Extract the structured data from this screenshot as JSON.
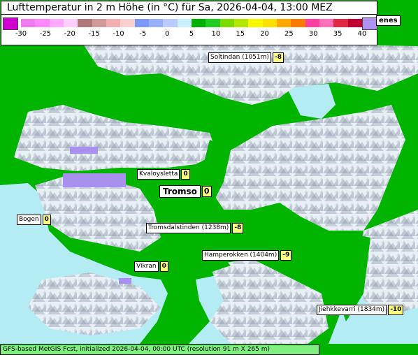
{
  "title": "Lufttemperatur in 2 m Höhe (in °C) für Sa, 2026-04-04, 13:00 MEZ",
  "scale": {
    "colors": [
      "#f07cf0",
      "#ff88ff",
      "#ffaaff",
      "#ffcfff",
      "#b07878",
      "#d09a9a",
      "#f0b0b0",
      "#f8d0d0",
      "#7c98f8",
      "#98b0fa",
      "#b8caff",
      "#c8f0ff",
      "#00b000",
      "#22cc22",
      "#7cdc00",
      "#b4e800",
      "#f8f800",
      "#fce000",
      "#ffa800",
      "#ff7800",
      "#ff40a0",
      "#ff70b8",
      "#e02840",
      "#c00030"
    ],
    "ticks": [
      "-30",
      "-25",
      "-20",
      "-15",
      "-10",
      "-5",
      "0",
      "5",
      "10",
      "15",
      "20",
      "25",
      "30",
      "35",
      "40"
    ]
  },
  "partial_label": "enes",
  "places": [
    {
      "name": "Soltindan (1051m)",
      "value": "-8"
    },
    {
      "name": "Kvaloysletta",
      "value": "0"
    },
    {
      "name": "Tromso",
      "value": "0"
    },
    {
      "name": "Bogen",
      "value": "0"
    },
    {
      "name": "Tromsdalstinden (1238m)",
      "value": "-8"
    },
    {
      "name": "Hamperokken (1404m)",
      "value": "-9"
    },
    {
      "name": "Vikran",
      "value": "0"
    },
    {
      "name": "Jiehkkevarri (1834m)",
      "value": "-10"
    }
  ],
  "footer": "GFS-based MetGIS Fcst, initialized 2026-04-04, 00:00 UTC  (resolution 91 m X 265 m)",
  "map_colors": {
    "water_green": "#00b400",
    "sea_cyan": "#b4ecf4",
    "snow": "#e6eef4",
    "shade": "#8a96a4",
    "cold_purple": "#a890f0"
  }
}
